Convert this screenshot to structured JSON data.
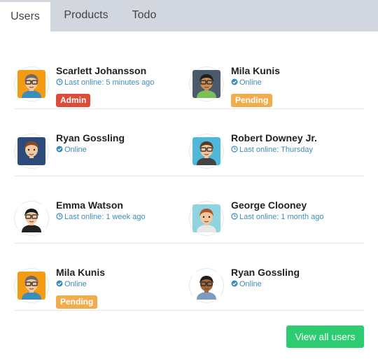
{
  "tabs": [
    {
      "label": "Users",
      "active": true
    },
    {
      "label": "Products",
      "active": false
    },
    {
      "label": "Todo",
      "active": false
    }
  ],
  "users": [
    {
      "name": "Scarlett Johansson",
      "status": "Last online: 5 minutes ago",
      "status_icon": "clock-icon",
      "badge": "Admin",
      "badge_color": "#dd4b39",
      "avatar_bg": "#f39c12",
      "avatar_skin": "#f2c8a0",
      "avatar_hair": "#6b6b6b",
      "avatar_shirt": "#3c8dbc",
      "glasses": true
    },
    {
      "name": "Mila Kunis",
      "status": "Online",
      "status_icon": "check-circle-icon",
      "badge": "Pending",
      "badge_color": "#f0ad4e",
      "avatar_bg": "#4a5a6a",
      "avatar_skin": "#c98f5a",
      "avatar_hair": "#1e1e1e",
      "avatar_shirt": "#7bbf5a",
      "glasses": true
    },
    {
      "name": "Ryan Gossling",
      "status": "Online",
      "status_icon": "check-circle-icon",
      "badge": "",
      "badge_color": "",
      "avatar_bg": "#2c4b7a",
      "avatar_skin": "#f2c8a0",
      "avatar_hair": "#8a4b1e",
      "avatar_shirt": "#2c4b7a",
      "glasses": false
    },
    {
      "name": "Robert Downey Jr.",
      "status": "Last online: Thursday",
      "status_icon": "clock-icon",
      "badge": "",
      "badge_color": "",
      "avatar_bg": "#4fb7d8",
      "avatar_skin": "#f2c8a0",
      "avatar_hair": "#5a3a1e",
      "avatar_shirt": "#444444",
      "glasses": true
    },
    {
      "name": "Emma Watson",
      "status": "Last online: 1 week ago",
      "status_icon": "clock-icon",
      "badge": "",
      "badge_color": "",
      "avatar_bg": "#ffffff",
      "avatar_skin": "#f2c8a0",
      "avatar_hair": "#1a1a1a",
      "avatar_shirt": "#222222",
      "glasses": true
    },
    {
      "name": "George Clooney",
      "status": "Last online: 1 month ago",
      "status_icon": "clock-icon",
      "badge": "",
      "badge_color": "",
      "avatar_bg": "#8fd3e0",
      "avatar_skin": "#f2c8a0",
      "avatar_hair": "#b0542a",
      "avatar_shirt": "#e8e8e8",
      "glasses": false
    },
    {
      "name": "Mila Kunis",
      "status": "Online",
      "status_icon": "check-circle-icon",
      "badge": "Pending",
      "badge_color": "#f0ad4e",
      "avatar_bg": "#f39c12",
      "avatar_skin": "#f2c8a0",
      "avatar_hair": "#6b6b6b",
      "avatar_shirt": "#3c8dbc",
      "glasses": true
    },
    {
      "name": "Ryan Gossling",
      "status": "Online",
      "status_icon": "check-circle-icon",
      "badge": "",
      "badge_color": "",
      "avatar_bg": "#ffffff",
      "avatar_skin": "#a0673a",
      "avatar_hair": "#1e1e1e",
      "avatar_shirt": "#7a9cc0",
      "glasses": true
    }
  ],
  "footer": {
    "view_all_label": "View all users",
    "button_color": "#2ecc71"
  }
}
